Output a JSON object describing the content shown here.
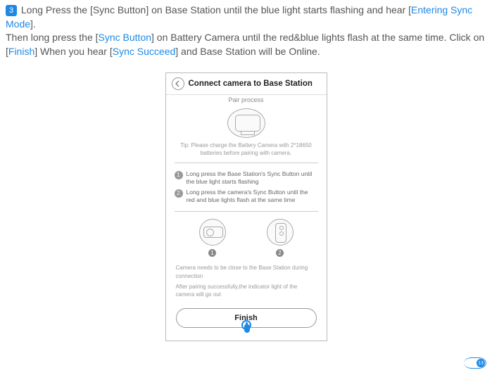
{
  "instruction": {
    "step_number": "3",
    "line1_pre": " Long Press the [Sync Button] on Base Station until the blue light starts flashing and hear [",
    "line1_link": "Entering Sync Mode",
    "line1_post": "].",
    "line2_pre": "Then long press the [",
    "line2_link1": "Sync Button",
    "line2_mid": "] on Battery Camera until the red&blue lights flash at the same time. Click on [",
    "line2_link2": "Finish",
    "line2_mid2": "] When you hear [",
    "line2_link3": "Sync Succeed",
    "line2_post": "] and Base Station will be Online."
  },
  "phone": {
    "title": "Connect camera to Base Station",
    "subtitle": "Pair process",
    "tip": "Tip: Please charge the Battery Camera with 2*18650 batteries before pairing with camera.",
    "steps": [
      {
        "num": "1",
        "text": "Long press the Base Station's Sync Button until the blue light starts flashing"
      },
      {
        "num": "2",
        "text": "Long press the camera's Sync Button until the red and blue lights flash at the same time"
      }
    ],
    "device_labels": {
      "one": "1",
      "two": "2"
    },
    "notes": {
      "n1": "Camera needs to be close to the Base Station during connection",
      "n2": "After pairing successfully,the indicator light of the camera will go out"
    },
    "finish_label": "Finish"
  },
  "page_number": "13"
}
